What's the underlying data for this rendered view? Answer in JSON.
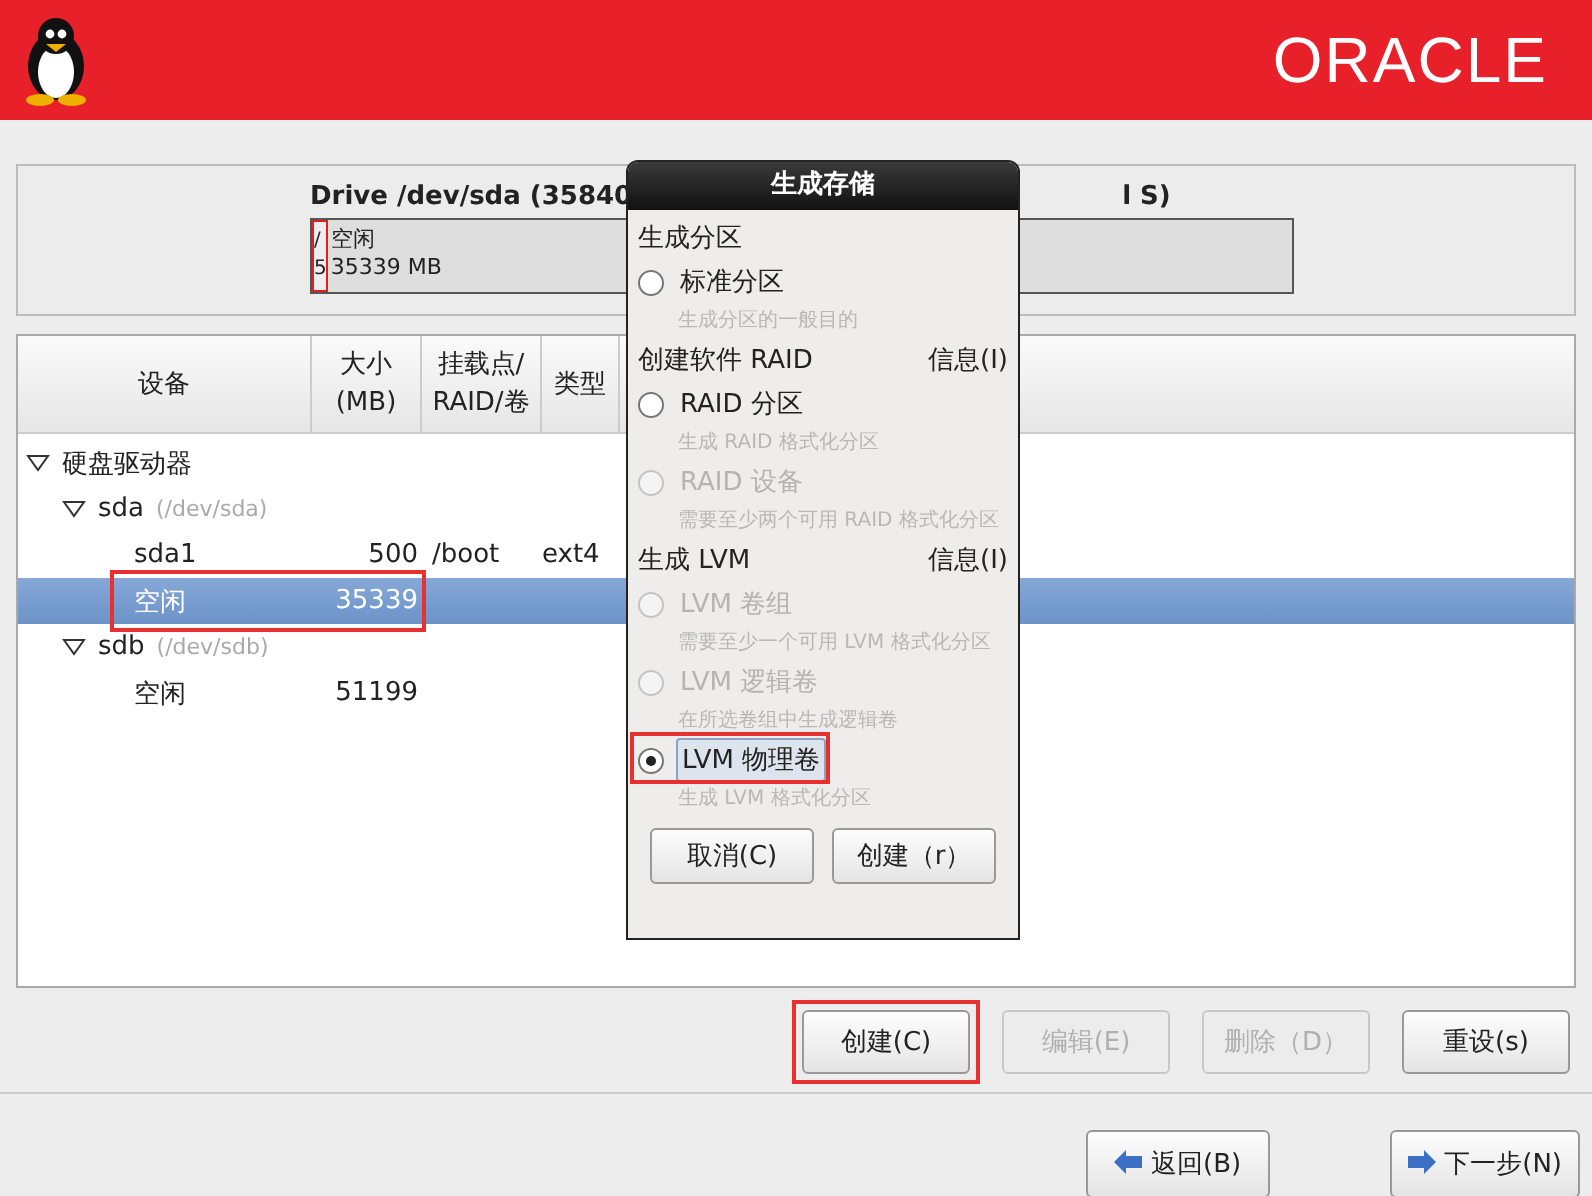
{
  "header": {
    "logo": "ORACLE"
  },
  "drive": {
    "title": "Drive /dev/sda (35840",
    "title_tail": "l S)",
    "segments": [
      {
        "kind": "partition",
        "lines": [
          "/",
          "5"
        ]
      },
      {
        "kind": "free",
        "lines": [
          "空闲",
          "35339 MB"
        ]
      }
    ]
  },
  "table": {
    "columns": [
      [
        "设备"
      ],
      [
        "大小",
        "(MB)"
      ],
      [
        "挂载点/",
        "RAID/卷"
      ],
      [
        "类型"
      ]
    ],
    "rows": [
      {
        "name": "硬盘驱动器",
        "expanded": true,
        "selected": false,
        "highlighted": false,
        "children": [
          {
            "name": "sda",
            "path": "(/dev/sda)",
            "expanded": true,
            "selected": false,
            "highlighted": false,
            "children": [
              {
                "name": "sda1",
                "size": "500",
                "mount": "/boot",
                "type": "ext4",
                "selected": false,
                "highlighted": false
              },
              {
                "name": "空闲",
                "size": "35339",
                "selected": true,
                "highlighted": true
              }
            ]
          },
          {
            "name": "sdb",
            "path": "(/dev/sdb)",
            "expanded": true,
            "selected": false,
            "highlighted": false,
            "children": [
              {
                "name": "空闲",
                "size": "51199",
                "selected": false,
                "highlighted": false
              }
            ]
          }
        ]
      }
    ]
  },
  "dialog": {
    "title": "生成存储",
    "sections": [
      {
        "heading": "生成分区",
        "options": [
          {
            "label": "标准分区",
            "hint": "生成分区的一般目的",
            "selected": false,
            "disabled": false,
            "focused": false,
            "highlighted": false
          }
        ]
      },
      {
        "heading": "创建软件 RAID",
        "info": "信息(I)",
        "options": [
          {
            "label": "RAID 分区",
            "hint": "生成 RAID 格式化分区",
            "selected": false,
            "disabled": false,
            "focused": false,
            "highlighted": false
          },
          {
            "label": "RAID 设备",
            "hint": "需要至少两个可用 RAID 格式化分区",
            "selected": false,
            "disabled": true,
            "focused": false,
            "highlighted": false
          }
        ]
      },
      {
        "heading": "生成 LVM",
        "info": "信息(I)",
        "options": [
          {
            "label": "LVM 卷组",
            "hint": "需要至少一个可用 LVM 格式化分区",
            "selected": false,
            "disabled": true,
            "focused": false,
            "highlighted": false
          },
          {
            "label": "LVM 逻辑卷",
            "hint": "在所选卷组中生成逻辑卷",
            "selected": false,
            "disabled": true,
            "focused": false,
            "highlighted": false
          },
          {
            "label": "LVM 物理卷",
            "hint": "生成 LVM 格式化分区",
            "selected": true,
            "disabled": false,
            "focused": true,
            "highlighted": true
          }
        ]
      }
    ],
    "buttons": [
      "取消(C)",
      "创建（r）"
    ]
  },
  "actions": [
    {
      "label": "创建(C)",
      "disabled": false,
      "highlighted": true
    },
    {
      "label": "编辑(E)",
      "disabled": true,
      "highlighted": false
    },
    {
      "label": "删除（D）",
      "disabled": true,
      "highlighted": false
    },
    {
      "label": "重设(s)",
      "disabled": false,
      "highlighted": false
    }
  ],
  "navigation": [
    {
      "label": "返回(B)",
      "kind": "back"
    },
    {
      "label": "下一步(N)",
      "kind": "next"
    }
  ]
}
